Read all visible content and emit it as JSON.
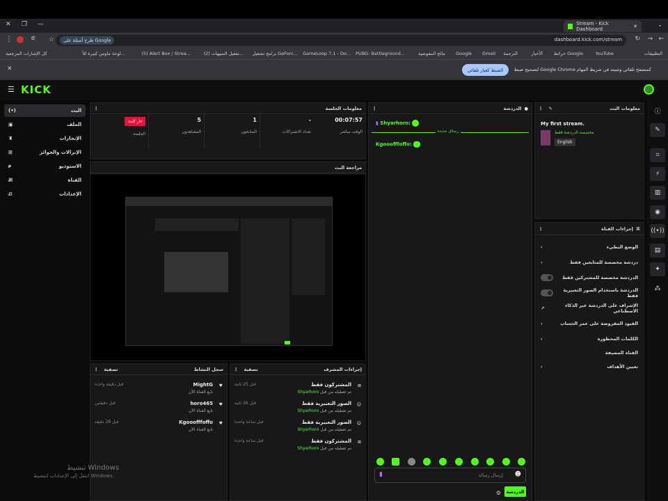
{
  "browser": {
    "tab_title": "Stream - Kick Dashboard",
    "url": "dashboard.kick.com/stream",
    "search_chip": "طرح أسئلة على Google"
  },
  "bookmarks": [
    "التطبيقات",
    "YouTube",
    "خرائط Google",
    "الأخبار",
    "الترجمة",
    "Gmail",
    "Google",
    "نتائج المفوضية",
    "PUBG: Battleground...",
    "GameLoop 7.1 - Do...",
    "برامج تشغيل GeForc...",
    "(2) تفعيل التنبيهات...",
    "(5) Alert Box / Strea...",
    "لوحة ماوس كبيرة للأ...",
    "كل الإشارات المرجعية"
  ],
  "infobar": {
    "text": "لتصحيح ضبط Google Chrome كمتصفح تلقائي وتثبيته في شريط المهام",
    "button": "الضبط كعيار تلقائي"
  },
  "sidebar": [
    {
      "label": "البث",
      "icon": "live-icon"
    },
    {
      "label": "الملف",
      "icon": "profile-icon"
    },
    {
      "label": "الإنجازات",
      "icon": "trophy-icon"
    },
    {
      "label": "الإنزالات والجوائز",
      "icon": "gift-icon"
    },
    {
      "label": "الاستوديو",
      "icon": "studio-icon"
    },
    {
      "label": "القناة",
      "icon": "channel-icon"
    },
    {
      "label": "الإعدادات",
      "icon": "gear-icon"
    }
  ],
  "session": {
    "title": "معلومات الجلسة",
    "live_badge": "جار البث",
    "session_label": "الجلسة",
    "stats": [
      {
        "value": "00:07:57",
        "label": "الوقت مباشر"
      },
      {
        "value": "-",
        "label": "تعداد الاشتراكات"
      },
      {
        "value": "1",
        "label": "المتابعون"
      },
      {
        "value": "5",
        "label": "المشاهدون"
      }
    ]
  },
  "preview": {
    "title": "مراجعة البث"
  },
  "chat": {
    "title": "الدردشة",
    "messages": [
      {
        "user": "Shyarhoro:",
        "text": ""
      },
      {
        "user": "Kgooofffoffo:",
        "text": ""
      }
    ],
    "divider": "رسائل جديدة",
    "input_placeholder": "إرسال رسالة",
    "send_button": "الدردشة"
  },
  "stream_info": {
    "title": "معلومات البث",
    "stream_title": "My first stream.",
    "category": "مخصصة الدردشة فقط",
    "language": "English"
  },
  "channel_actions": {
    "title": "إجراءات القناة",
    "items": [
      {
        "label": "الوضع البطيء",
        "control": "chevron"
      },
      {
        "label": "دردشة مخصصة للمتابعين فقط",
        "control": "chevron"
      },
      {
        "label": "الدردشة مخصصة للمشتركين فقط",
        "control": "toggle"
      },
      {
        "label": "الدردشة باستخدام الصور التعبيرية فقط",
        "control": "toggle"
      },
      {
        "label": "الإشراف على الدردشة عبر الذكاء الاصطناعي",
        "control": "external"
      },
      {
        "label": "القيود المفروضة على عمر الحساب",
        "control": "chevron"
      },
      {
        "label": "الكلمات المحظورة",
        "control": "chevron"
      },
      {
        "label": "القناة المضيفة",
        "control": "none"
      },
      {
        "label": "تعيين الأهداف",
        "control": "chevron"
      }
    ]
  },
  "activity": {
    "title": "سجل النشاط",
    "filter": "تصفية",
    "items": [
      {
        "user": "MightG",
        "sub": "تابع القناة الآن",
        "time": "قبل دقيقة واحدة"
      },
      {
        "user": "horo465",
        "sub": "تابع القناة الآن",
        "time": "قبل دقيقتين"
      },
      {
        "user": "Kgooofffoffo",
        "sub": "تابع القناة الآن",
        "time": "قبل 28 دقيقة"
      }
    ]
  },
  "mod_actions": {
    "title": "إجراءات المشرف",
    "filter": "تصفية",
    "items": [
      {
        "title": "المشتركون فقط",
        "sub": "تم تعطيله من قبل",
        "by": "Shyarhoro",
        "time": "قبل 25 ثانية"
      },
      {
        "title": "الصور التعبيرية فقط",
        "sub": "تم تعطيله من قبل",
        "by": "Shyarhoro",
        "time": "قبل 26 ثانية"
      },
      {
        "title": "الصور التعبيرية فقط",
        "sub": "تم تعطيله من قبل",
        "by": "Shyarhoro",
        "time": "قبل ساعة واحدة"
      },
      {
        "title": "المشتركون فقط",
        "sub": "تم تعطيله من قبل",
        "by": "Shyarhoro",
        "time": "قبل ساعة واحدة"
      }
    ]
  },
  "watermark": {
    "line1": "تنشيط Windows",
    "line2": "انتقل إلى الإعدادات لتنشيط Windows."
  },
  "colors": {
    "accent": "#53fc18",
    "live": "#e3143b"
  }
}
